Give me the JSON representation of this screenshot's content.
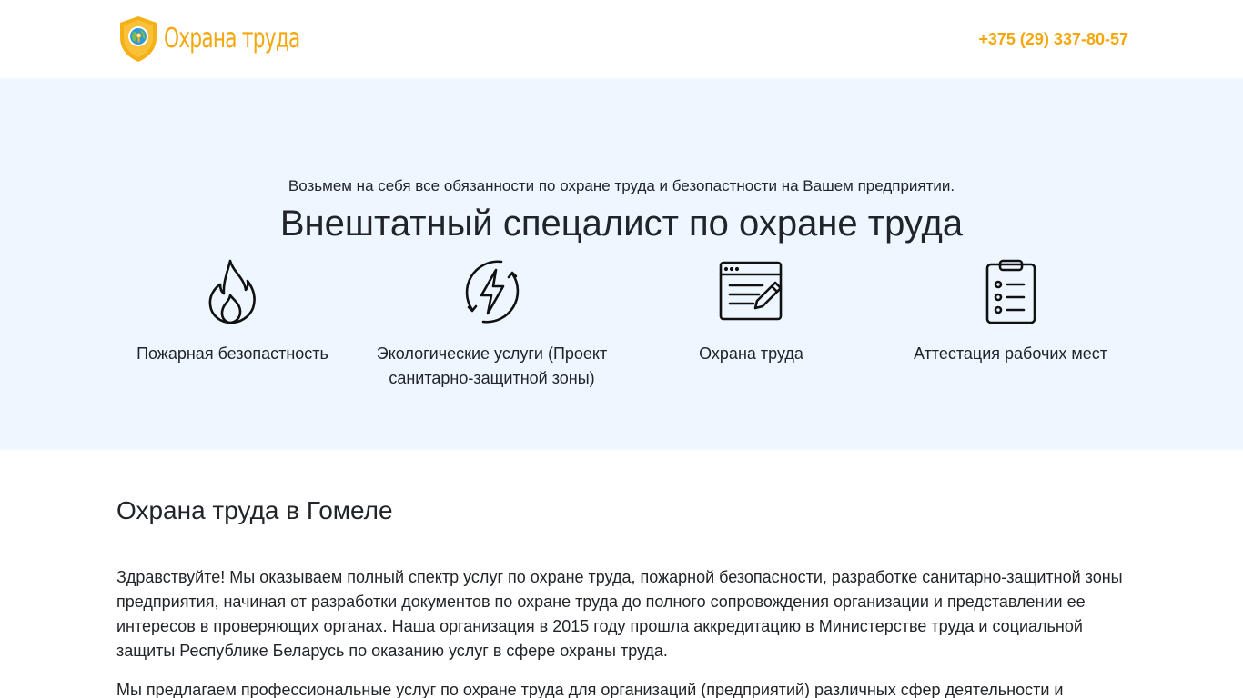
{
  "header": {
    "logo_alt": "logo",
    "logo_text": "Охрана труда",
    "phone": "+375 (29) 337-80-57"
  },
  "hero": {
    "title": "Внештатный спецалист по охране труда",
    "lead": "Возьмем на себя все обязанности по охране труда и безопастности на Вашем предприятии.",
    "features": [
      {
        "label": "Пожарная безопастность",
        "icon": "flame-icon"
      },
      {
        "label": "Экологические услуги (Проект санитарно-защитной зоны)",
        "icon": "lightning-circle-icon"
      },
      {
        "label": "Охрана труда",
        "icon": "document-edit-icon"
      },
      {
        "label": "Аттестация рабочих мест",
        "icon": "clipboard-checklist-icon"
      }
    ]
  },
  "content": {
    "heading": "Охрана труда в Гомеле",
    "paragraphs": [
      "Здравствуйте! Мы оказываем полный спектр услуг по охране труда, пожарной безопасности, разработке санитарно-защитной зоны предприятия, начиная от разработки документов по охране труда до полного сопровождения организации и представлении ее интересов в проверяющих органах. Наша организация в 2015 году прошла аккредитацию в Министерстве труда и социальной защиты Республике Беларусь по оказанию услуг в сфере охраны труда.",
      "Мы предлагаем профессиональные услуг по охране труда для организаций (предприятий) различных сфер деятельности и"
    ]
  },
  "colors": {
    "accent": "#f5a60a",
    "hero_bg": "#eef6ff",
    "text": "#212529"
  }
}
